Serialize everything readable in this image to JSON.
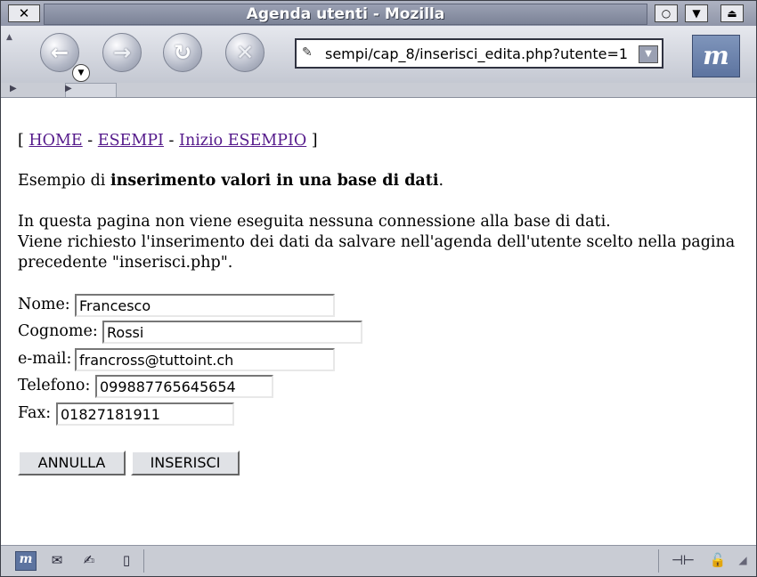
{
  "window": {
    "title": "Agenda utenti - Mozilla",
    "close_glyph": "✕",
    "buttons": [
      "○",
      "▼",
      "⏏"
    ]
  },
  "toolbar": {
    "back": "←",
    "forward": "→",
    "reload": "↻",
    "stop": "✕",
    "url": "sempi/cap_8/inserisci_edita.php?utente=1",
    "logo": "m"
  },
  "breadcrumb": {
    "open": "[",
    "home": "HOME",
    "sep1": "-",
    "esempi": "ESEMPI",
    "sep2": "-",
    "inizio": "Inizio ESEMPIO",
    "close": "]"
  },
  "intro": {
    "prefix": "Esempio di",
    "bold": "inserimento valori in una base di dati",
    "suffix": "."
  },
  "description": [
    "In questa pagina non viene eseguita nessuna connessione alla base di dati.",
    "Viene richiesto l'inserimento dei dati da salvare nell'agenda dell'utente scelto nella pagina",
    "precedente \"inserisci.php\"."
  ],
  "form": {
    "nome": {
      "label": "Nome:",
      "value": "Francesco"
    },
    "cognome": {
      "label": "Cognome:",
      "value": "Rossi"
    },
    "email": {
      "label": "e-mail:",
      "value": "francross@tuttoint.ch"
    },
    "telefono": {
      "label": "Telefono:",
      "value": "099887765645654"
    },
    "fax": {
      "label": "Fax:",
      "value": "01827181911"
    },
    "cancel_label": "ANNULLA",
    "submit_label": "INSERISCI"
  },
  "statusbar": {
    "icons": [
      "mozilla-icon",
      "mail-icon",
      "composer-icon",
      "addressbook-icon",
      "online-icon",
      "lock-icon"
    ]
  }
}
